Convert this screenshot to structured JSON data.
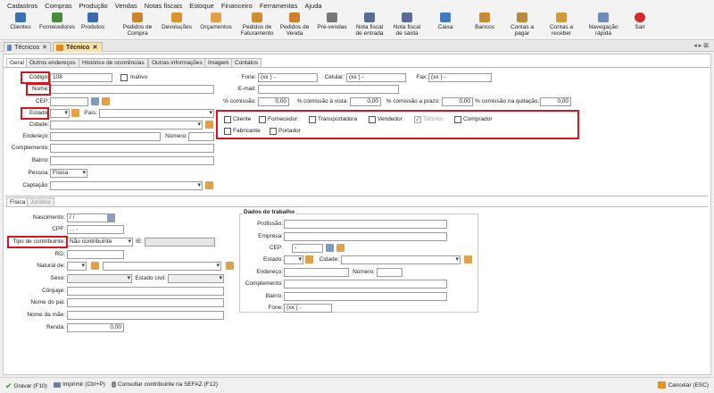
{
  "menu": [
    "Cadastros",
    "Compras",
    "Produção",
    "Vendas",
    "Notas fiscais",
    "Estoque",
    "Financeiro",
    "Ferramentas",
    "Ajuda"
  ],
  "toolbar": [
    {
      "l1": "",
      "l2": "Clientes",
      "color": "#3d6fb3"
    },
    {
      "l1": "",
      "l2": "Fornecedores",
      "color": "#4a8b3d"
    },
    {
      "l1": "",
      "l2": "Produtos",
      "color": "#3e6aa8"
    },
    {
      "l1": "Pedidos de",
      "l2": "Compra",
      "color": "#c9862c"
    },
    {
      "l1": "",
      "l2": "Devoluções",
      "color": "#d9942f"
    },
    {
      "l1": "",
      "l2": "Orçamentos",
      "color": "#e0a04a"
    },
    {
      "l1": "Pedidos de",
      "l2": "Faturamento",
      "color": "#d48a30"
    },
    {
      "l1": "Pedidos de",
      "l2": "Venda",
      "color": "#cf7f2b"
    },
    {
      "l1": "",
      "l2": "Pré-vendas",
      "color": "#777"
    },
    {
      "l1": "Nota fiscal",
      "l2": "de entrada",
      "color": "#5a6d91"
    },
    {
      "l1": "Nota fiscal",
      "l2": "de saída",
      "color": "#5a6d91"
    },
    {
      "l1": "",
      "l2": "Caixa",
      "color": "#3f7bbf"
    },
    {
      "l1": "",
      "l2": "Bancos",
      "color": "#c78c33"
    },
    {
      "l1": "Contas a",
      "l2": "pagar",
      "color": "#b68b3e"
    },
    {
      "l1": "Contas a",
      "l2": "receber",
      "color": "#cf9a39"
    },
    {
      "l1": "Navegação",
      "l2": "rápida",
      "color": "#6b8bb8"
    },
    {
      "l1": "",
      "l2": "Sair",
      "color": "#d22c2c"
    }
  ],
  "doctabs": {
    "tab1": "Técnicos",
    "tab2": "Técnico"
  },
  "formtabs": [
    "Geral",
    "Outros endereços",
    "Histórico de ocorrências",
    "Outras informações",
    "Imagem",
    "Contatos"
  ],
  "left": {
    "codigo_label": "Código:",
    "codigo_value": "108",
    "inativo_label": "Inativo",
    "nome_label": "Nome:",
    "cep_label": "CEP:",
    "estado_label": "Estado:",
    "pais_label": "País:",
    "cidade_label": "Cidade:",
    "endereco_label": "Endereço:",
    "numero_label": "Número:",
    "complemento_label": "Complemento:",
    "bairro_label": "Bairro:",
    "pessoa_label": "Pessoa:",
    "pessoa_value": "Física",
    "captacao_label": "Captação:"
  },
  "right": {
    "fone_label": "Fone:",
    "fone_value": "(xx )    -",
    "celular_label": "Celular:",
    "celular_value": "(xx )    -",
    "fax_label": "Fax:",
    "fax_value": "(xx )    -",
    "email_label": "E-mail:",
    "comissao_label": "% comissão:",
    "comissao_value": "0,00",
    "vista_label": "% comissão à vista:",
    "vista_value": "0,00",
    "prazo_label": "% comissão a prazo:",
    "prazo_value": "0,00",
    "quitacao_label": "% comissão na quitação:",
    "quitacao_value": "0,00"
  },
  "roles": [
    "Cliente",
    "Fornecedor",
    "Transportadora",
    "Vendedor",
    "Técnico",
    "Comprador",
    "Fabricante",
    "Portador"
  ],
  "persontabs": [
    "Física",
    "Jurídica"
  ],
  "fisica": {
    "nascimento_label": "Nascimento:",
    "nascimento_value": " / /",
    "cpf_label": "CPF:",
    "cpf_value": ".   .   -",
    "tipo_label": "Tipo de contribuinte:",
    "tipo_value": "Não contribuinte",
    "ie_label": "IE:",
    "rg_label": "RG:",
    "natural_label": "Natural de:",
    "sexo_label": "Sexo:",
    "estadocivil_label": "Estado civil:",
    "conjuge_label": "Cônjuge:",
    "pai_label": "Nome do pai:",
    "mae_label": "Nome da mãe:",
    "renda_label": "Renda:",
    "renda_value": "0,00"
  },
  "trabalho": {
    "title": "Dados do trabalho",
    "profissao_label": "Profissão:",
    "empresa_label": "Empresa:",
    "cep_label": "CEP:",
    "cep_value": "-",
    "estado_label": "Estado:",
    "cidade_label": "Cidade:",
    "endereco_label": "Endereço:",
    "numero_label": "Número:",
    "complemento_label": "Complemento:",
    "bairro_label": "Bairro:",
    "fone_label": "Fone:",
    "fone_value": "(xx )    -"
  },
  "status": {
    "gravar": "Gravar (F10)",
    "imprimir": "Imprimir (Ctrl+P)",
    "consultar": "Consultar contribuinte na SEFAZ (F12)",
    "cancelar": "Cancelar (ESC)"
  },
  "colors": {
    "highlight": "#d8141c",
    "active_tab": "#fbe3a6"
  }
}
